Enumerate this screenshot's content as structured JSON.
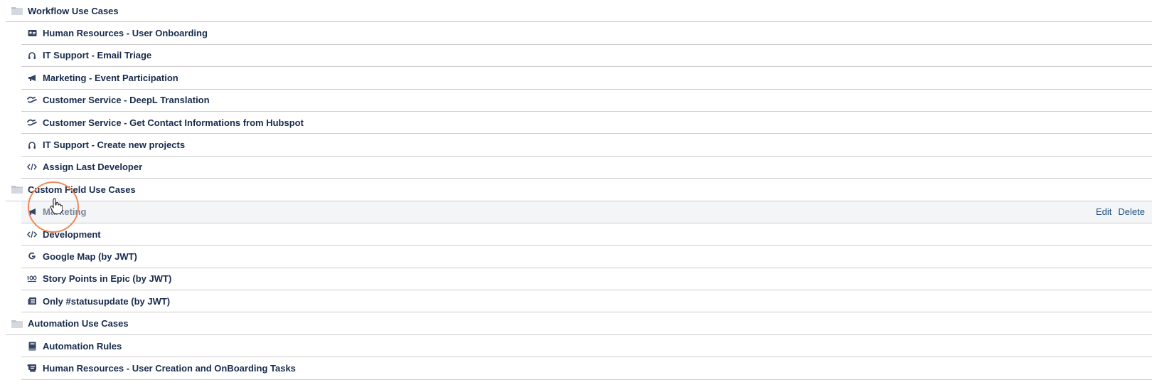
{
  "groups": [
    {
      "title": "Workflow Use Cases",
      "icon": "folder-icon",
      "items": [
        {
          "label": "Human Resources - User Onboarding",
          "icon": "id-card-icon"
        },
        {
          "label": "IT Support - Email Triage",
          "icon": "headset-icon"
        },
        {
          "label": "Marketing - Event Participation",
          "icon": "megaphone-icon"
        },
        {
          "label": "Customer Service - DeepL Translation",
          "icon": "handshake-icon"
        },
        {
          "label": "Customer Service - Get Contact Informations from Hubspot",
          "icon": "handshake-icon"
        },
        {
          "label": "IT Support - Create new projects",
          "icon": "headset-icon"
        },
        {
          "label": "Assign Last Developer",
          "icon": "code-icon"
        }
      ]
    },
    {
      "title": "Custom Field Use Cases",
      "icon": "folder-icon",
      "items": [
        {
          "label": "Marketing",
          "icon": "megaphone-icon"
        },
        {
          "label": "Development",
          "icon": "code-icon"
        },
        {
          "label": "Google Map (by JWT)",
          "icon": "google-icon"
        },
        {
          "label": "Story Points in Epic (by JWT)",
          "icon": "hundred-points-icon"
        },
        {
          "label": "Only #statusupdate (by JWT)",
          "icon": "newspaper-icon"
        }
      ]
    },
    {
      "title": "Automation Use Cases",
      "icon": "folder-icon",
      "items": [
        {
          "label": "Automation Rules",
          "icon": "book-icon"
        },
        {
          "label": "Human Resources - User Creation and OnBoarding Tasks",
          "icon": "scroll-icon"
        }
      ]
    }
  ],
  "actions": {
    "edit": "Edit",
    "delete": "Delete"
  },
  "colors": {
    "text": "#172b4d",
    "link": "#205081",
    "hover_bg": "#f4f5f7",
    "cursor_ring": "#f08a5d"
  }
}
